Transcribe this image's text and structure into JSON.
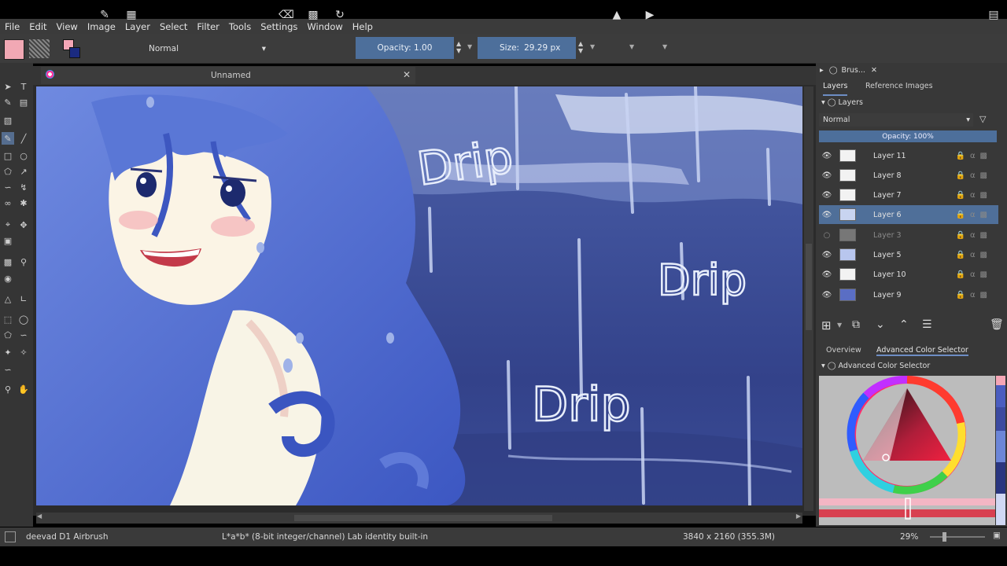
{
  "menu": [
    "File",
    "Edit",
    "View",
    "Image",
    "Layer",
    "Select",
    "Filter",
    "Tools",
    "Settings",
    "Window",
    "Help"
  ],
  "toolbar": {
    "blend_mode": "Normal",
    "opacity_label": "Opacity: 1.00",
    "size_label": "Size:",
    "size_value": "29.29 px"
  },
  "canvas": {
    "document_tab": "Unnamed",
    "drip_texts": [
      "Drip",
      "Drip",
      "Drip"
    ]
  },
  "dock": {
    "brush_tab": "Brus...",
    "tabs": [
      "Layers",
      "Reference Images"
    ],
    "layers_title": "Layers",
    "blend_mode": "Normal",
    "opacity": "Opacity:  100%",
    "layers": [
      {
        "name": "Layer 11",
        "visible": true,
        "selected": false
      },
      {
        "name": "Layer 8",
        "visible": true,
        "selected": false
      },
      {
        "name": "Layer 7",
        "visible": true,
        "selected": false
      },
      {
        "name": "Layer 6",
        "visible": true,
        "selected": true
      },
      {
        "name": "Layer 3",
        "visible": false,
        "selected": false
      },
      {
        "name": "Layer 5",
        "visible": true,
        "selected": false
      },
      {
        "name": "Layer 10",
        "visible": true,
        "selected": false
      },
      {
        "name": "Layer 9",
        "visible": true,
        "selected": false
      }
    ],
    "bottom_tabs": [
      "Overview",
      "Advanced Color Selector"
    ],
    "color_selector_title": "Advanced Color Selector"
  },
  "status": {
    "brush": "deevad D1 Airbrush",
    "color_space": "L*a*b* (8-bit integer/channel)  Lab identity built-in",
    "dimensions": "3840 x 2160 (355.3M)",
    "zoom": "29%"
  },
  "colors": {
    "accent": "#4d6f9b",
    "selected_layer": "#4f6f99",
    "foreground": "#f4a6b6"
  }
}
